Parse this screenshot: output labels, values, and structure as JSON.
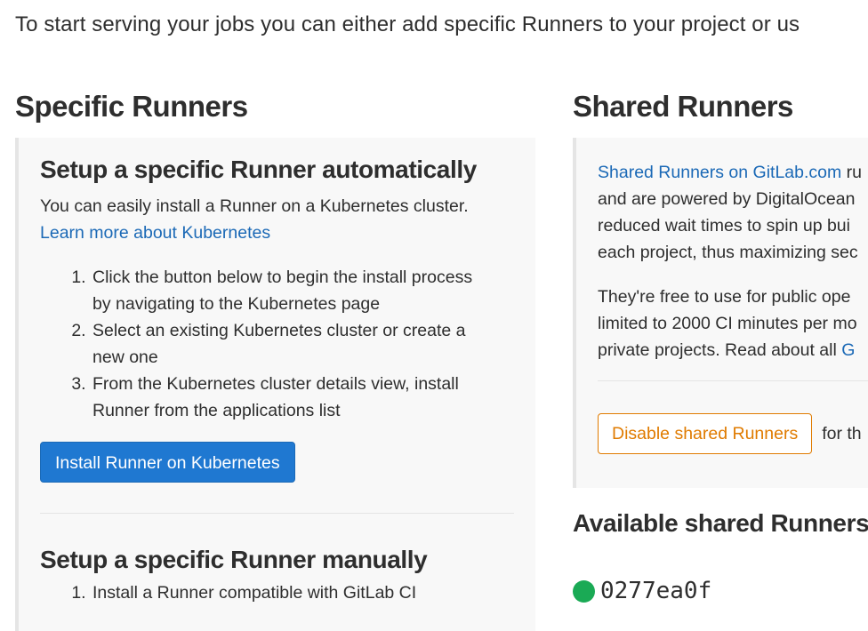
{
  "intro_text": "To start serving your jobs you can either add specific Runners to your project or us",
  "specific": {
    "heading": "Specific Runners",
    "auto": {
      "title": "Setup a specific Runner automatically",
      "description": "You can easily install a Runner on a Kubernetes cluster.",
      "learn_more": "Learn more about Kubernetes",
      "steps": [
        {
          "line1": "Click the button below to begin the install process",
          "line2": "by navigating to the Kubernetes page"
        },
        {
          "line1": "Select an existing Kubernetes cluster or create a",
          "line2": "new one"
        },
        {
          "line1": "From the Kubernetes cluster details view, install",
          "line2": "Runner from the applications list"
        }
      ],
      "install_button": "Install Runner on Kubernetes"
    },
    "manual": {
      "title": "Setup a specific Runner manually",
      "steps": [
        "Install a Runner compatible with GitLab CI"
      ]
    }
  },
  "shared": {
    "heading": "Shared Runners",
    "link_text": "Shared Runners on GitLab.com",
    "p1_tail": " ru",
    "p1_lines": [
      "and are powered by DigitalOcean",
      "reduced wait times to spin up bui",
      "each project, thus maximizing sec"
    ],
    "p2_lines": [
      "They're free to use for public ope",
      "limited to 2000 CI minutes per mo",
      "private projects. Read about all "
    ],
    "p2_link": "G",
    "disable_button": "Disable shared Runners",
    "after_button": "for th",
    "available_heading": "Available shared Runners",
    "runners": [
      {
        "id": "0277ea0f",
        "status_color": "#1aaa55"
      }
    ]
  }
}
